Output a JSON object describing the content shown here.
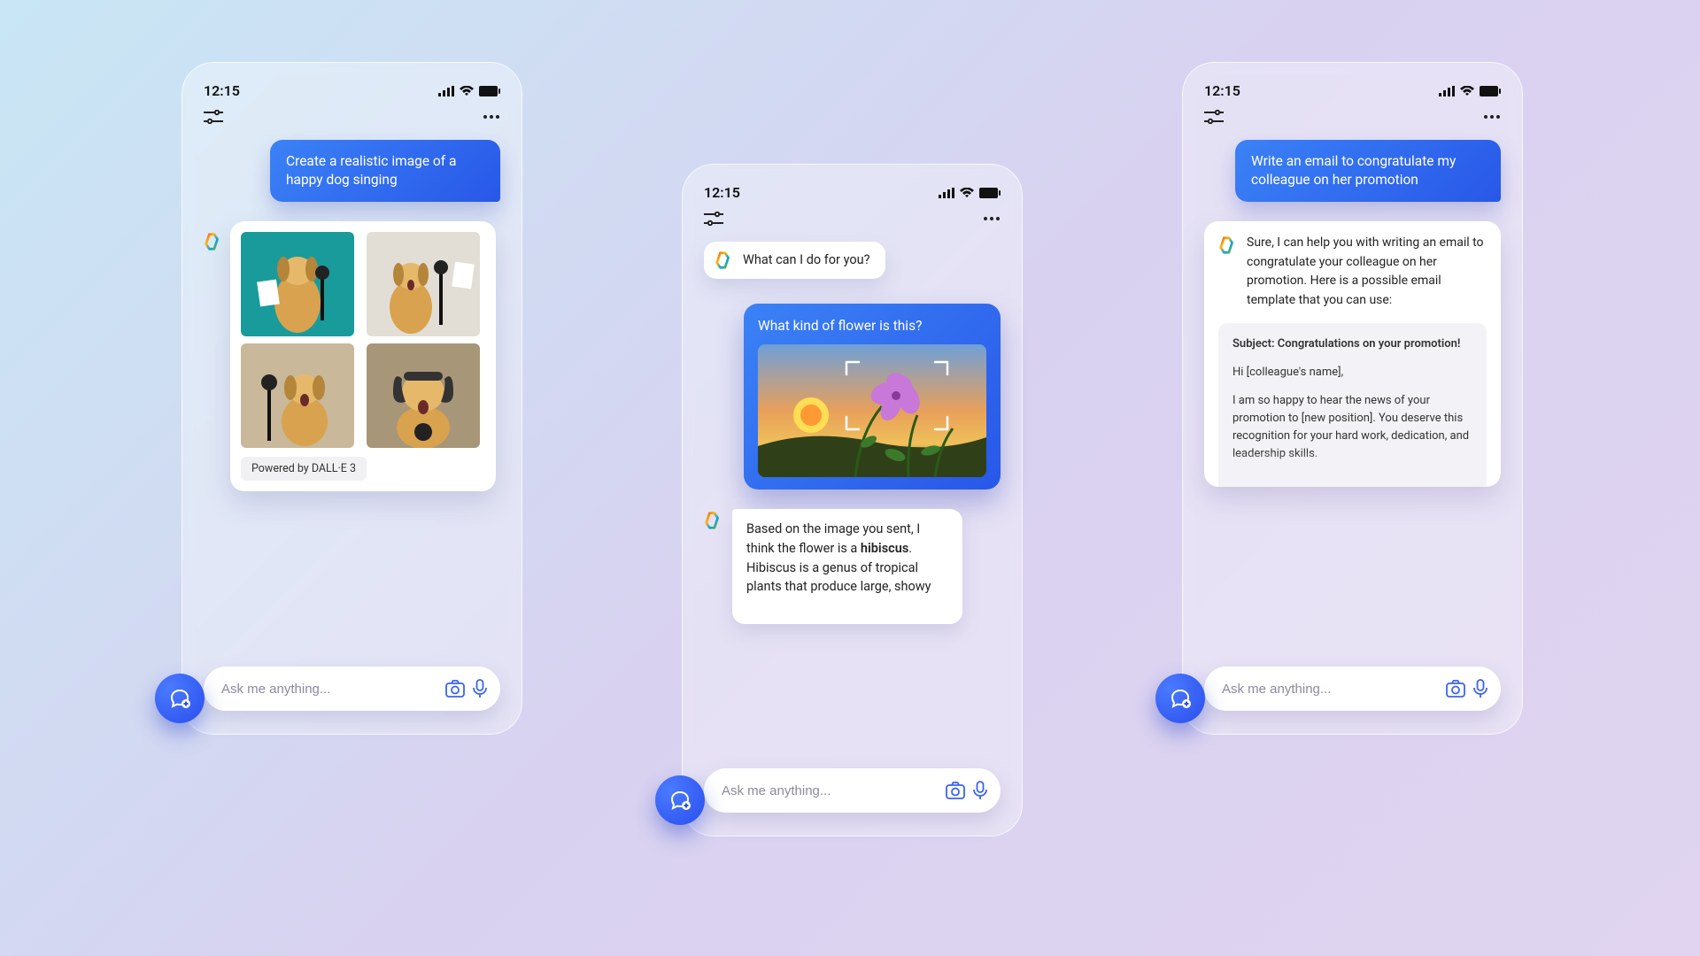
{
  "status": {
    "time": "12:15"
  },
  "input": {
    "placeholder": "Ask me anything..."
  },
  "phone1": {
    "user_msg": "Create a realistic image of a happy dog singing",
    "powered": "Powered by DALL·E 3"
  },
  "phone2": {
    "greet": "What can I do for you?",
    "user_q": "What kind of flower is this?",
    "reply_pre": "Based on the image you sent, I think the flower is a ",
    "reply_bold": "hibiscus",
    "reply_post": ". Hibiscus is a genus of tropical plants that produce large, showy"
  },
  "phone3": {
    "user_msg": "Write an email to congratulate my colleague on her promotion",
    "reply_intro": "Sure, I can help you with writing an email to congratulate your colleague on her promotion. Here is a possible email template that you can use:",
    "email_subject": "Subject: Congratulations on your promotion!",
    "email_hi": "Hi [colleague's name],",
    "email_body": "I am so happy to hear the news of your promotion to [new position]. You deserve this recognition for your hard work, dedication, and leadership skills."
  }
}
